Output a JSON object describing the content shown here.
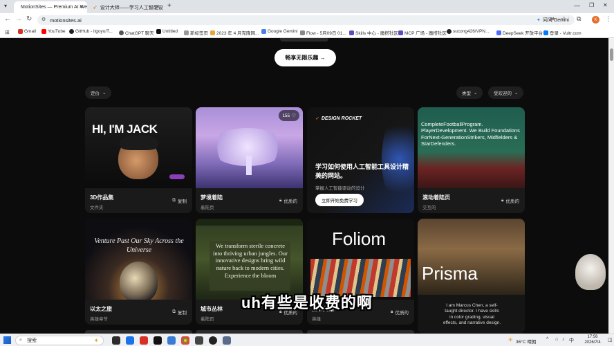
{
  "tabs": [
    {
      "title": "MotionSites — Premium AI We"
    },
    {
      "title": "设计大师——学习人工智能设计"
    }
  ],
  "toolbar": {
    "ask_gemini": "问问 Gemini"
  },
  "address": {
    "url": "motionsites.ai"
  },
  "bookmarks": [
    "Gmail",
    "YouTube",
    "GitHub - itgoyo/T...",
    "ChatGPT 聊天",
    "Untitled",
    "新标签页",
    "2023 年 4 月克隆网...",
    "Google Gemini",
    "Flow - 5月09日 01...",
    "Skills 中心 - 魔搭社区",
    "MCP 广场 - 魔搭社区",
    "sucong426/VPN...",
    "DeepSeek 开放平台",
    "登录 - Vultr.com"
  ],
  "page": {
    "cta_label": "畅享无限乐趣 →",
    "filters": {
      "price": "定价",
      "type": "类型",
      "popular": "受欢迎的"
    },
    "cards": [
      {
        "title": "3D作品集",
        "sub": "文件夹",
        "action": "复制",
        "thumb_text": "HI, I'M JACK"
      },
      {
        "title": "梦境着陆",
        "sub": "着陆页",
        "action": "优质的",
        "likes": "155"
      },
      {
        "title": "学习如何使用人工智能工具设计精美的网站。",
        "sub": "掌握人工智能驱动的设计",
        "action": "立即开始免费学习",
        "brand": "DESIGN ROCKET"
      },
      {
        "title": "滚动着陆页",
        "sub": "交互的",
        "action": "优质的",
        "thumb_text": "CompleteFootballProgram. PlayerDevelopment. We Build Foundations ForNext-GenerationStrikers, Midfielders & StarDefenders."
      },
      {
        "title": "以太之旅",
        "sub": "英雄章节",
        "action": "复制",
        "thumb_text": "Venture Past Our Sky Across the Universe"
      },
      {
        "title": "城市丛林",
        "sub": "着陆页",
        "action": "优质的",
        "thumb_text": "We transform sterile concrete into thriving urban jungles. Our innovative designs bring wild nature back to modern cities. Experience the bloom"
      },
      {
        "title": "图书英雄",
        "sub": "英雄",
        "action": "优质的",
        "thumb_text": "Foliom"
      },
      {
        "title": "",
        "sub": "",
        "action": "",
        "thumb_text": "Prisma",
        "thumb_text2": "I am Marcus Chen, a self-taught director. I have skills in color grading, visual effects, and narrative design."
      }
    ]
  },
  "subtitle": "uh有些是收费的啊",
  "taskbar": {
    "search_placeholder": "搜索",
    "weather": "36°C 晴朗",
    "ime": "中",
    "time": "17:56",
    "date": "2026/7/4"
  },
  "colors": {
    "accent_orange": "#e36f2c",
    "page_bg": "#0c0c0c",
    "card_bg": "#1a1a1a"
  }
}
